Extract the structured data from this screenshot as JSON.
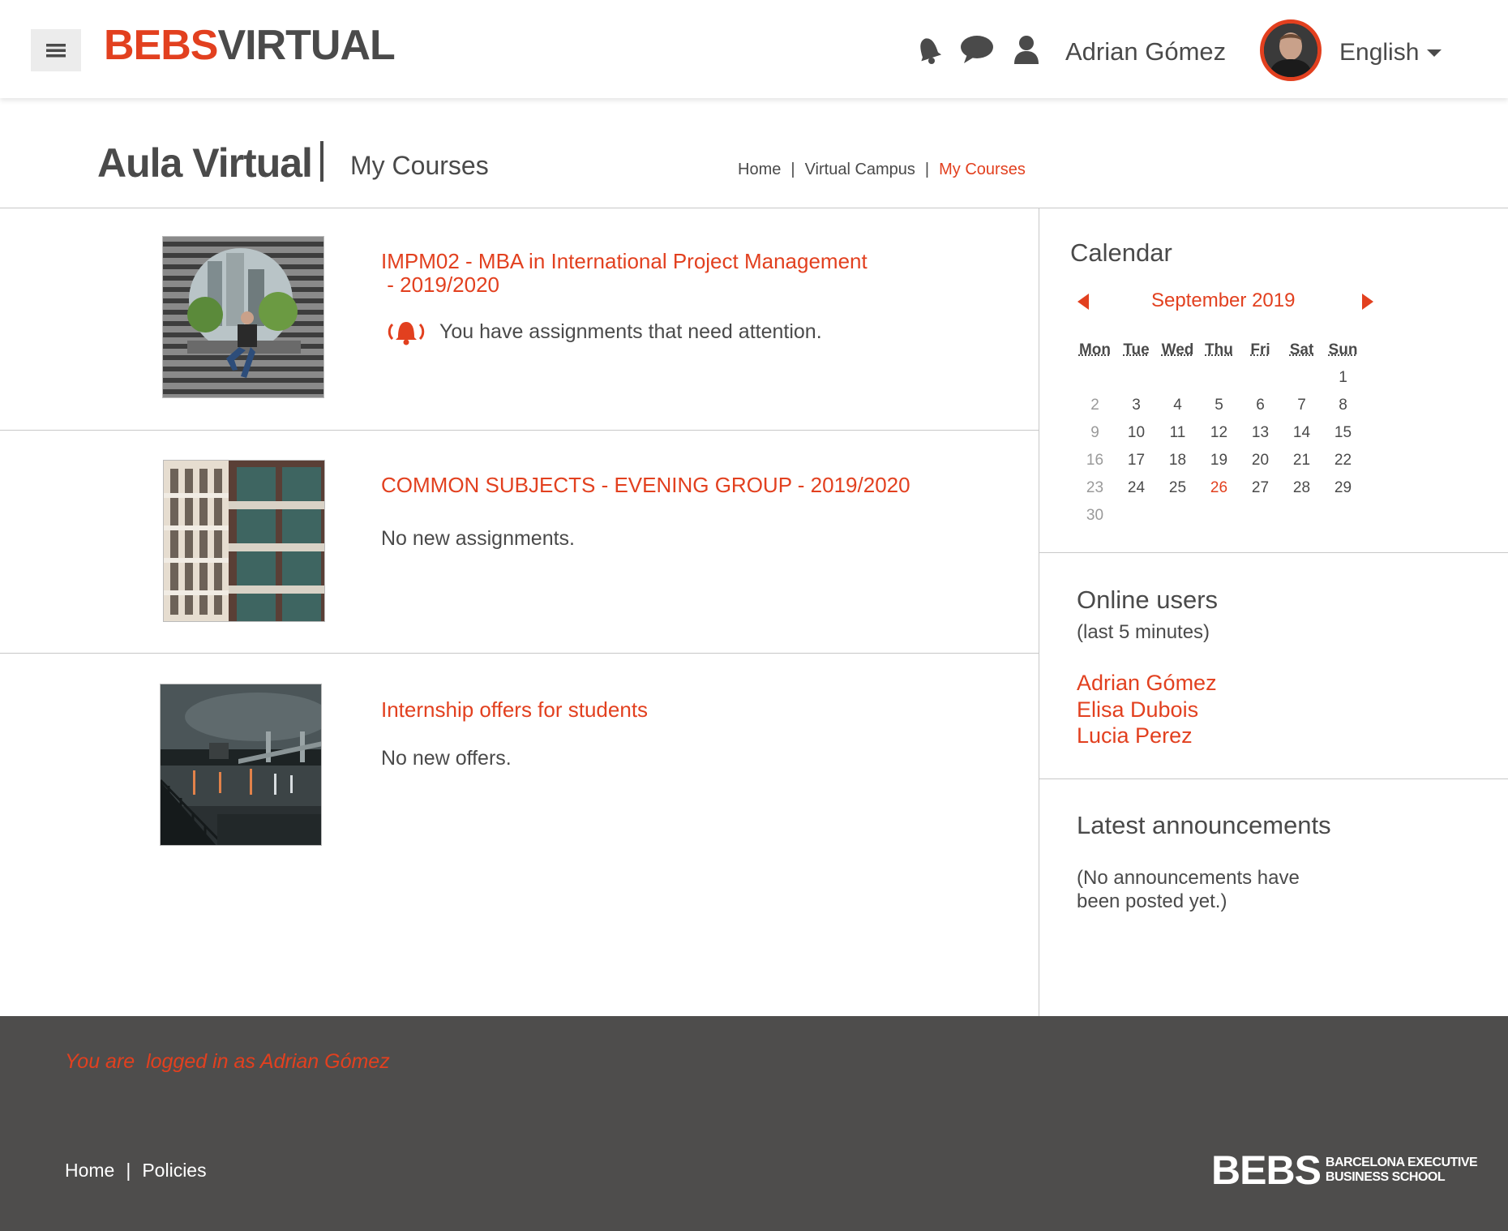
{
  "header": {
    "logo_primary": "BEBS",
    "logo_secondary": "VIRTUAL",
    "user_name": "Adrian Gómez",
    "language": "English",
    "icons": [
      "menu-icon",
      "notifications-bell-icon",
      "messages-icon",
      "profile-icon"
    ]
  },
  "page": {
    "title": "Aula Virtual",
    "subtitle": "My Courses",
    "breadcrumb": [
      {
        "label": "Home"
      },
      {
        "label": "Virtual Campus"
      },
      {
        "label": "My Courses"
      }
    ]
  },
  "courses": [
    {
      "title_line1": "IMPM02 - MBA in International Project Management",
      "title_line2": " - 2019/2020",
      "status": "You have assignments that need attention.",
      "status_icon": "alert-bell-icon"
    },
    {
      "title_line1": "COMMON SUBJECTS - EVENING GROUP - 2019/2020",
      "status": "No new assignments."
    },
    {
      "title_line1": "Internship offers for students",
      "status": "No new offers."
    }
  ],
  "calendar": {
    "heading": "Calendar",
    "month": "September 2019",
    "weekdays": [
      "Mon",
      "Tue",
      "Wed",
      "Thu",
      "Fri",
      "Sat",
      "Sun"
    ],
    "weeks": [
      [
        "",
        "",
        "",
        "",
        "",
        "",
        "1"
      ],
      [
        "2",
        "3",
        "4",
        "5",
        "6",
        "7",
        "8"
      ],
      [
        "9",
        "10",
        "11",
        "12",
        "13",
        "14",
        "15"
      ],
      [
        "16",
        "17",
        "18",
        "19",
        "20",
        "21",
        "22"
      ],
      [
        "23",
        "24",
        "25",
        "26",
        "27",
        "28",
        "29"
      ],
      [
        "30",
        "",
        "",
        "",
        "",
        "",
        ""
      ]
    ],
    "highlight_day": "26",
    "accent_color": "#e2401f"
  },
  "online_users": {
    "heading": "Online users",
    "subheading": "(last 5 minutes)",
    "users": [
      "Adrian Gómez",
      "Elisa Dubois",
      "Lucia Perez"
    ]
  },
  "announcements": {
    "heading": "Latest announcements",
    "line1": "(No announcements have",
    "line2": "been posted yet.)"
  },
  "footer": {
    "login_note": "You are  logged in as Adrian Gómez",
    "links": [
      "Home",
      "Policies"
    ],
    "logo_big": "BEBS",
    "logo_small_line1": "BARCELONA EXECUTIVE",
    "logo_small_line2": "BUSINESS SCHOOL"
  },
  "colors": {
    "accent": "#e2401f",
    "text": "#4a4a4a",
    "footer_bg": "#4e4d4c"
  }
}
